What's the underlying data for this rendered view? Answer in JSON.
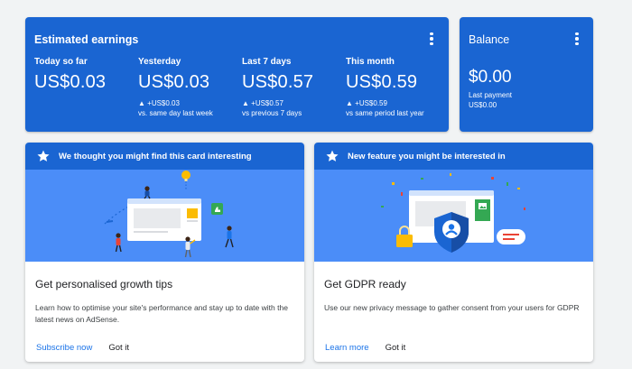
{
  "earnings": {
    "title": "Estimated earnings",
    "metrics": [
      {
        "label": "Today so far",
        "value": "US$0.03",
        "change": "",
        "sub": ""
      },
      {
        "label": "Yesterday",
        "value": "US$0.03",
        "change": "▲ +US$0.03",
        "sub": "vs. same day last week"
      },
      {
        "label": "Last 7 days",
        "value": "US$0.57",
        "change": "▲ +US$0.57",
        "sub": "vs previous 7 days"
      },
      {
        "label": "This month",
        "value": "US$0.59",
        "change": "▲ +US$0.59",
        "sub": "vs same period last year"
      }
    ]
  },
  "balance": {
    "title": "Balance",
    "value": "$0.00",
    "last_payment_label": "Last payment",
    "last_payment_value": "US$0.00"
  },
  "cards": [
    {
      "header": "We thought you might find this card interesting",
      "title": "Get personalised growth tips",
      "description": "Learn how to optimise your site's performance and stay up to date with the latest news on AdSense.",
      "primary_action": "Subscribe now",
      "secondary_action": "Got it"
    },
    {
      "header": "New feature you might be interested in",
      "title": "Get GDPR ready",
      "description": "Use our new privacy message to gather consent from your users for GDPR",
      "primary_action": "Learn more",
      "secondary_action": "Got it"
    }
  ],
  "colors": {
    "brand_blue": "#1a65d2",
    "hero_blue": "#4b8df8",
    "link_blue": "#1a73e8",
    "background": "#f1f3f4"
  },
  "icons": {
    "menu": "more-vert-icon",
    "card_header": "star-icon"
  }
}
